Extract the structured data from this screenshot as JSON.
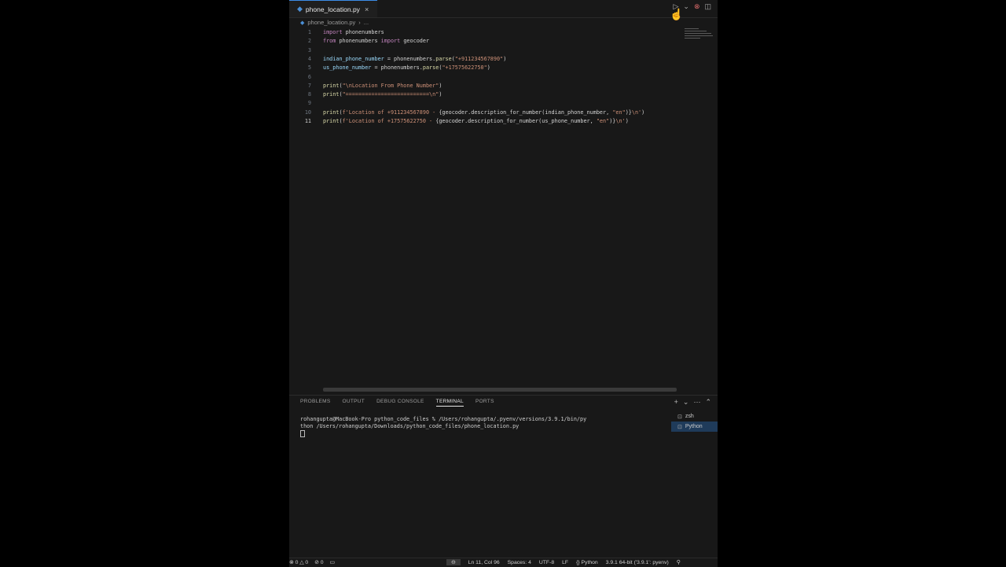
{
  "tab": {
    "label": "phone_location.py",
    "close": "×"
  },
  "breadcrumb": {
    "file": "phone_location.py",
    "more": "..."
  },
  "editor": {
    "line_numbers": [
      "1",
      "2",
      "3",
      "4",
      "5",
      "6",
      "7",
      "8",
      "9",
      "10",
      "11"
    ],
    "lines": [
      {
        "parts": [
          {
            "t": "import",
            "c": "kw"
          },
          {
            "t": " phonenumbers",
            "c": ""
          }
        ]
      },
      {
        "parts": [
          {
            "t": "from",
            "c": "kw"
          },
          {
            "t": " phonenumbers ",
            "c": ""
          },
          {
            "t": "import",
            "c": "kw"
          },
          {
            "t": " geocoder",
            "c": ""
          }
        ]
      },
      {
        "parts": []
      },
      {
        "parts": [
          {
            "t": "indian_phone_number",
            "c": "var"
          },
          {
            "t": " = phonenumbers.",
            "c": ""
          },
          {
            "t": "parse",
            "c": "fn"
          },
          {
            "t": "(",
            "c": ""
          },
          {
            "t": "\"+911234567890\"",
            "c": "str"
          },
          {
            "t": ")",
            "c": ""
          }
        ]
      },
      {
        "parts": [
          {
            "t": "us_phone_number",
            "c": "var"
          },
          {
            "t": " = phonenumbers.",
            "c": ""
          },
          {
            "t": "parse",
            "c": "fn"
          },
          {
            "t": "(",
            "c": ""
          },
          {
            "t": "\"+17575622750\"",
            "c": "str"
          },
          {
            "t": ")",
            "c": ""
          }
        ]
      },
      {
        "parts": []
      },
      {
        "parts": [
          {
            "t": "print",
            "c": "fn"
          },
          {
            "t": "(",
            "c": ""
          },
          {
            "t": "\"\\nLocation From Phone Number\"",
            "c": "str"
          },
          {
            "t": ")",
            "c": ""
          }
        ]
      },
      {
        "parts": [
          {
            "t": "print",
            "c": "fn"
          },
          {
            "t": "(",
            "c": ""
          },
          {
            "t": "\"==========================\\n\"",
            "c": "str"
          },
          {
            "t": ")",
            "c": ""
          }
        ]
      },
      {
        "parts": []
      },
      {
        "parts": [
          {
            "t": "print",
            "c": "fn"
          },
          {
            "t": "(",
            "c": ""
          },
          {
            "t": "f'Location of +911234567890 - ",
            "c": "str"
          },
          {
            "t": "{geocoder.description_for_number(indian_phone_number, ",
            "c": ""
          },
          {
            "t": "\"en\"",
            "c": "str"
          },
          {
            "t": ")}",
            "c": ""
          },
          {
            "t": "\\n'",
            "c": "str"
          },
          {
            "t": ")",
            "c": ""
          }
        ]
      },
      {
        "parts": [
          {
            "t": "print",
            "c": "fn"
          },
          {
            "t": "(",
            "c": ""
          },
          {
            "t": "f'Location of +17575622750 - ",
            "c": "str"
          },
          {
            "t": "{geocoder.description_for_number(us_phone_number, ",
            "c": ""
          },
          {
            "t": "\"en\"",
            "c": "str"
          },
          {
            "t": ")}",
            "c": ""
          },
          {
            "t": "\\n'",
            "c": "str"
          },
          {
            "t": ")",
            "c": ""
          }
        ]
      }
    ]
  },
  "panel": {
    "tabs": [
      "PROBLEMS",
      "OUTPUT",
      "DEBUG CONSOLE",
      "TERMINAL",
      "PORTS"
    ],
    "active_tab": "TERMINAL",
    "terminal_lines": [
      "rohangupta@MacBook-Pro python_code_files % /Users/rohangupta/.pyenv/versions/3.9.1/bin/py",
      "thon /Users/rohangupta/Downloads/python_code_files/phone_location.py"
    ],
    "terminals": [
      "zsh",
      "Python"
    ]
  },
  "status": {
    "errors": "0",
    "warnings": "0",
    "ports": "0",
    "position": "Ln 11, Col 96",
    "spaces": "Spaces: 4",
    "encoding": "UTF-8",
    "eol": "LF",
    "language": "Python",
    "interpreter": "3.9.1 64-bit ('3.9.1': pyenv)"
  },
  "colors": {
    "accent": "#3c8ce7",
    "background": "#181818"
  }
}
